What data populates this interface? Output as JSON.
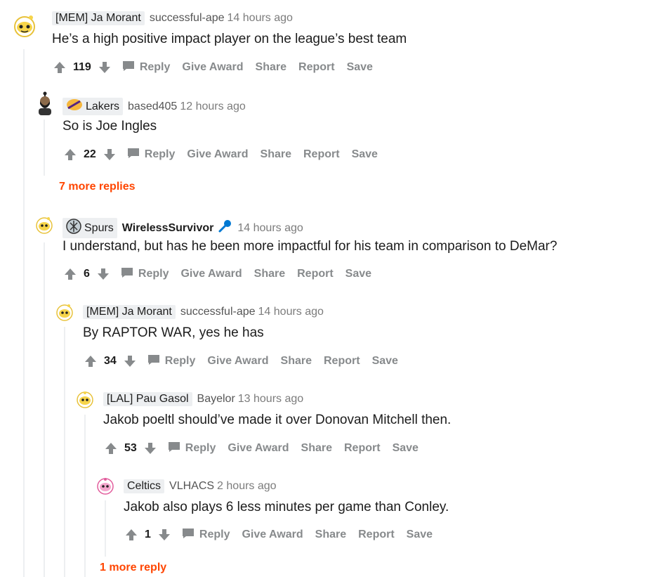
{
  "comments": [
    {
      "flair": "[MEM] Ja Morant",
      "user": "successful-ape",
      "time": "14 hours ago",
      "body": "He’s a high positive impact player on the league’s best team",
      "score": "119"
    },
    {
      "flair": "Lakers",
      "user": "based405",
      "time": "12 hours ago",
      "body": "So is Joe Ingles",
      "score": "22"
    },
    {
      "flair": "Spurs",
      "user": "WirelessSurvivor",
      "time": "14 hours ago",
      "body": "I understand, but has he been more impactful for his team in comparison to DeMar?",
      "score": "6"
    },
    {
      "flair": "[MEM] Ja Morant",
      "user": "successful-ape",
      "time": "14 hours ago",
      "body": "By RAPTOR WAR, yes he has",
      "score": "34"
    },
    {
      "flair": "[LAL] Pau Gasol",
      "user": "Bayelor",
      "time": "13 hours ago",
      "body": "Jakob poeltl should’ve made it over Donovan Mitchell then.",
      "score": "53"
    },
    {
      "flair": "Celtics",
      "user": "VLHACS",
      "time": "2 hours ago",
      "body": "Jakob also plays 6 less minutes per game than Conley.",
      "score": "1"
    }
  ],
  "actions": {
    "reply": "Reply",
    "give_award": "Give Award",
    "share": "Share",
    "report": "Report",
    "save": "Save"
  },
  "more_replies_1": "7 more replies",
  "more_replies_2": "1 more reply",
  "icons": {
    "upvote": "arrow-up-icon",
    "downvote": "arrow-down-icon",
    "reply": "chat-bubble-icon",
    "mic": "microphone-icon"
  },
  "colors": {
    "link": "#ff4500",
    "meta": "#7c7c7c",
    "action": "#878a8c",
    "flair_bg": "#edeff1"
  }
}
